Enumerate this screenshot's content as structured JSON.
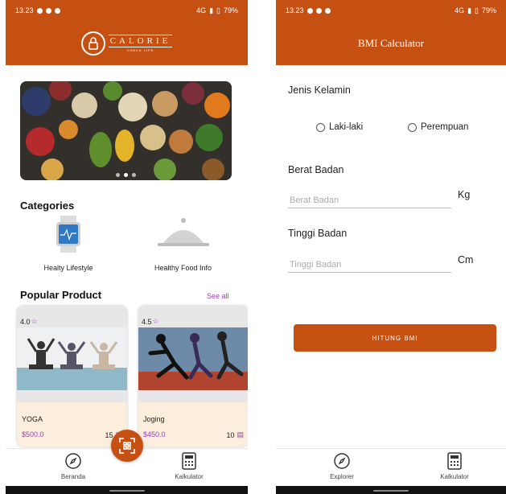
{
  "colors": {
    "accent": "#c55012",
    "price": "#9b3fb8",
    "card_bottom": "#fbeedd"
  },
  "left": {
    "status": {
      "time": "13.23",
      "right": "4G",
      "battery": "79%"
    },
    "logo": {
      "main": "CALORIE",
      "sub": "CHECK LIFE"
    },
    "categories_title": "Categories",
    "categories": [
      {
        "icon": "smartwatch-icon",
        "label": "Healty Lifestyle"
      },
      {
        "icon": "food-cloche-icon",
        "label": "Healthy Food Info"
      }
    ],
    "popular_title": "Popular Product",
    "see_all": "See all",
    "products": [
      {
        "rating": "4.0",
        "name": "YOGA",
        "price": "$500.0",
        "count": "15"
      },
      {
        "rating": "4.5",
        "name": "Joging",
        "price": "$450.0",
        "count": "10"
      }
    ],
    "nav": {
      "home": "Beranda",
      "calculator": "Kalkulator"
    }
  },
  "right": {
    "status": {
      "time": "13.23",
      "right": "4G",
      "battery": "79%"
    },
    "title": "BMI Calculator",
    "gender_label": "Jenis Kelamin",
    "gender_options": [
      "Laki-laki",
      "Perempuan"
    ],
    "weight_label": "Berat Badan",
    "weight_placeholder": "Berat Badan",
    "weight_unit": "Kg",
    "height_label": "Tinggi Badan",
    "height_placeholder": "Tinggi Badan",
    "height_unit": "Cm",
    "button": "HITUNG BMI",
    "nav": {
      "explorer": "Explorer",
      "calculator": "Kalkulator"
    }
  }
}
